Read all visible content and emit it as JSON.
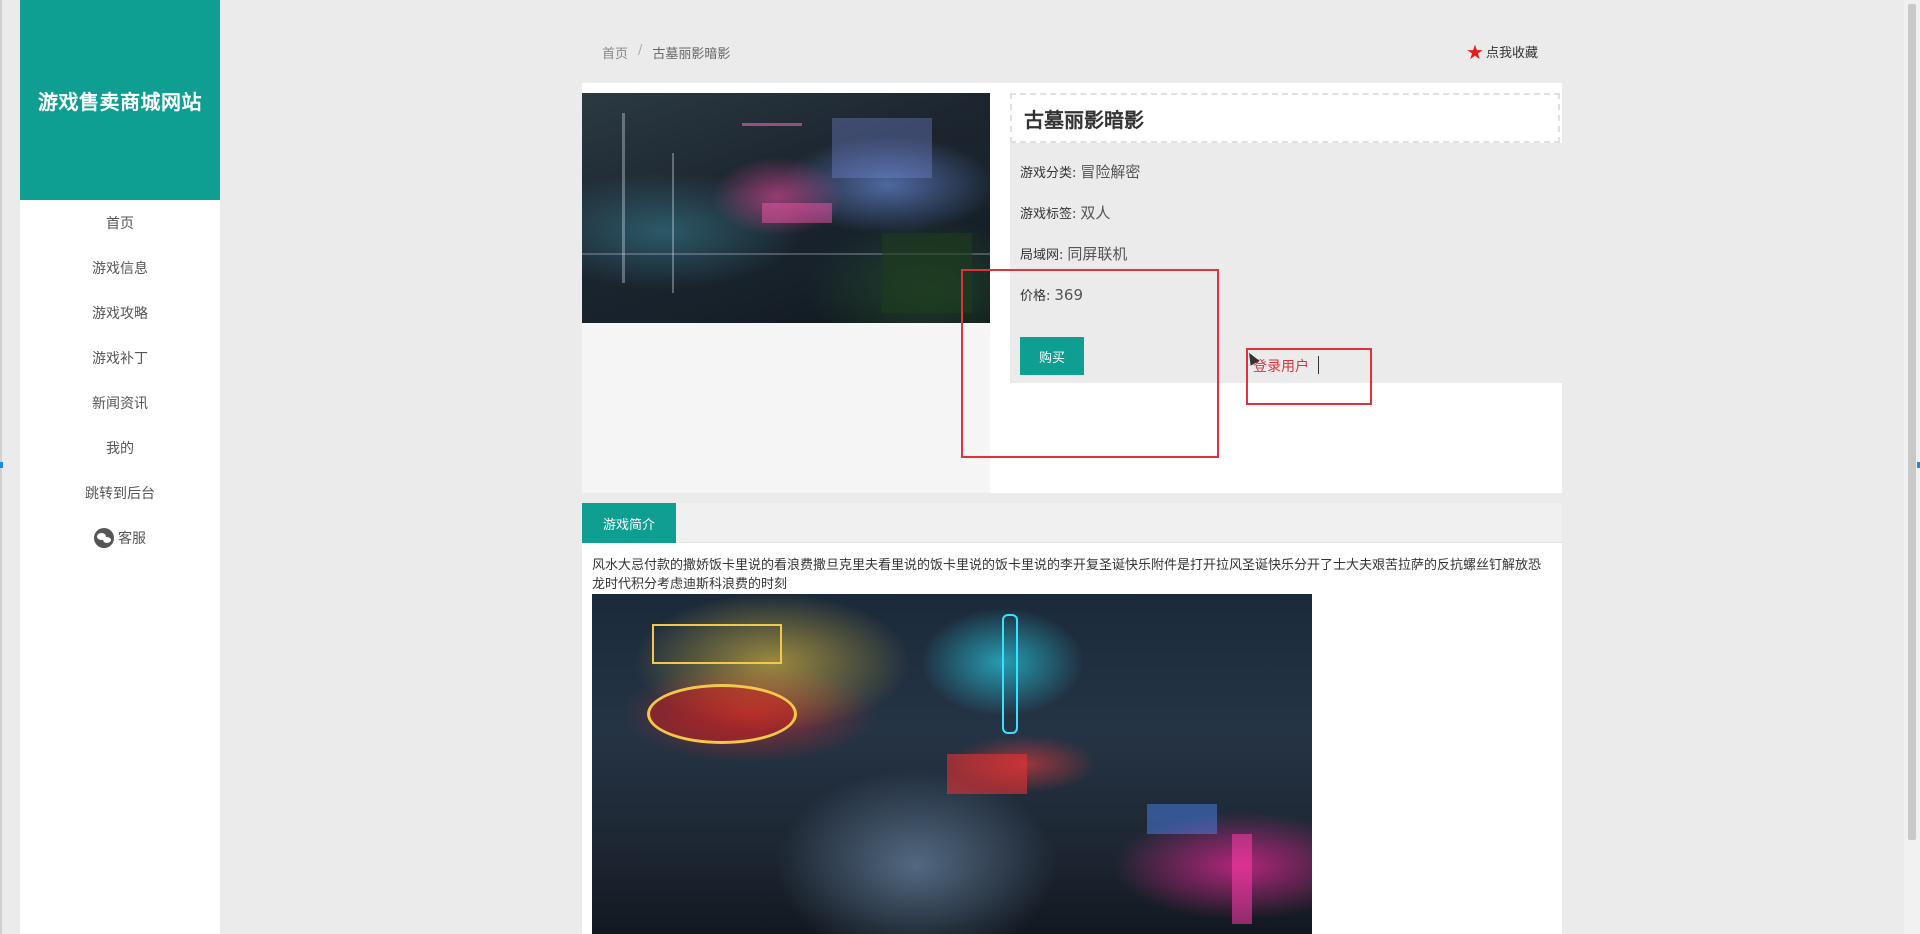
{
  "sidebar": {
    "brand_title": "游戏售卖商城网站",
    "items": [
      {
        "label": "首页"
      },
      {
        "label": "游戏信息"
      },
      {
        "label": "游戏攻略"
      },
      {
        "label": "游戏补丁"
      },
      {
        "label": "新闻资讯"
      },
      {
        "label": "我的"
      },
      {
        "label": "跳转到后台"
      },
      {
        "label": "客服",
        "icon": "wechat-icon"
      }
    ]
  },
  "breadcrumb": {
    "home": "首页",
    "separator": "/",
    "current": "古墓丽影暗影"
  },
  "favorite": {
    "icon": "star-icon",
    "label": "点我收藏"
  },
  "game": {
    "title": "古墓丽影暗影",
    "category_label": "游戏分类:",
    "category_value": "冒险解密",
    "tag_label": "游戏标签:",
    "tag_value": "双人",
    "lan_label": "局域网:",
    "lan_value": "同屏联机",
    "price_label": "价格:",
    "price_value": "369",
    "buy_label": "购买"
  },
  "annotation": {
    "login_text": "登录用户"
  },
  "intro": {
    "tab_label": "游戏简介",
    "text": "风水大忌付款的撒娇饭卡里说的看浪费撒旦克里夫看里说的饭卡里说的饭卡里说的李开复圣诞快乐附件是打开拉风圣诞快乐分开了士大夫艰苦拉萨的反抗螺丝钉解放恐龙时代积分考虑迪斯科浪费的时刻"
  },
  "colors": {
    "brand": "#0e9e92",
    "annotation_red": "#e0323c",
    "star": "#e81a1a"
  }
}
